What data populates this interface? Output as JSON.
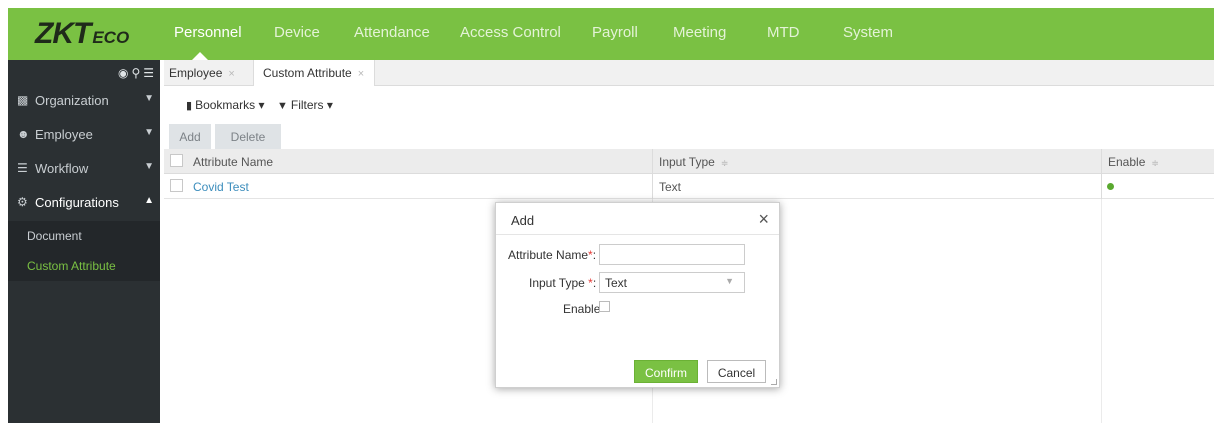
{
  "brand": {
    "logo_main": "ZKT",
    "logo_sub": "ECO"
  },
  "menu": {
    "items": [
      {
        "label": "Personnel",
        "active": true
      },
      {
        "label": "Device"
      },
      {
        "label": "Attendance"
      },
      {
        "label": "Access Control"
      },
      {
        "label": "Payroll"
      },
      {
        "label": "Meeting"
      },
      {
        "label": "MTD"
      },
      {
        "label": "System"
      }
    ]
  },
  "sidebar": {
    "tool_icons": [
      "tag-icon",
      "search-icon",
      "list-icon"
    ],
    "items": [
      {
        "label": "Organization",
        "icon": "org-icon",
        "expanded": false
      },
      {
        "label": "Employee",
        "icon": "users-icon",
        "expanded": false
      },
      {
        "label": "Workflow",
        "icon": "list-icon",
        "expanded": false
      },
      {
        "label": "Configurations",
        "icon": "gears-icon",
        "expanded": true
      }
    ],
    "sub_items": [
      {
        "label": "Document",
        "active": false
      },
      {
        "label": "Custom Attribute",
        "active": true
      }
    ]
  },
  "tabs": [
    {
      "label": "Employee",
      "close": "×"
    },
    {
      "label": "Custom Attribute",
      "close": "×"
    }
  ],
  "toolbar": {
    "bookmarks": "Bookmarks",
    "filters": "Filters"
  },
  "actions": {
    "add": "Add",
    "delete": "Delete"
  },
  "grid": {
    "columns": [
      "Attribute Name",
      "Input Type",
      "Enable"
    ],
    "sort_glyph": "≑",
    "rows": [
      {
        "name": "Covid Test",
        "input_type": "Text",
        "enabled": true
      }
    ]
  },
  "dialog": {
    "title": "Add",
    "close": "×",
    "attribute_name_label": "Attribute Name",
    "attribute_name_value": "",
    "input_type_label": "Input Type ",
    "input_type_value": "Text",
    "required_mark": "*",
    "colon": ":",
    "enable_label": "Enable",
    "enable_checked": false,
    "confirm": "Confirm",
    "cancel": "Cancel"
  },
  "colors": {
    "accent": "#7ac143",
    "sidebar": "#2b3033",
    "link": "#3c8dbc",
    "required": "#e53935"
  }
}
